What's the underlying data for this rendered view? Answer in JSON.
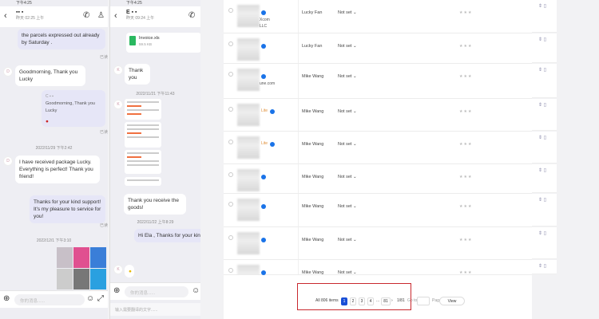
{
  "phone1": {
    "status": "下午4:25",
    "contact_sub": "昨天 02:25 上午",
    "read": "已读",
    "messages": [
      {
        "dir": "out",
        "text": "the parcels expressed out already by Saturday ."
      },
      {
        "dir": "in",
        "text": "Goodmorning, Thank you Lucky"
      },
      {
        "dir": "out",
        "quote": "Goodmorning, Thank you Lucky"
      },
      {
        "dir": "in",
        "text": "I have received package Lucky. Everything is perfect! Thank you friend!"
      },
      {
        "dir": "out",
        "text": "Thanks for your kind support! It's my pleasure to service for you!"
      }
    ],
    "timestamps": [
      "2022/11/29 下午2:42",
      "2022/12/1 下午3:10"
    ],
    "input_placeholder": "你的消息......"
  },
  "phone2": {
    "status": "下午4:25",
    "contact_sub": "昨天 09:24 上午",
    "file_name": "Invoice.xls",
    "file_size": "59.5 KB",
    "messages": [
      {
        "dir": "in",
        "text": "Thank you"
      },
      {
        "dir": "in",
        "text": "Thank you receive the goods!"
      },
      {
        "dir": "out",
        "text": "Hi Ela , Thanks for your kind support! It's my pleasure to service for you!"
      }
    ],
    "timestamps": [
      "2022/11/21 下午11:43",
      "2022/11/22 上午8:29"
    ],
    "input_placeholder": "你的消息......",
    "translate_placeholder": "输入需要翻译的文字......"
  },
  "table": {
    "rows": [
      {
        "owner": "Lucky Fan",
        "status": "Not set",
        "ext": [
          "Xcom",
          "LLC"
        ],
        "tag": ""
      },
      {
        "owner": "Lucky Fan",
        "status": "Not set",
        "ext": [],
        "tag": ""
      },
      {
        "owner": "Mike Wang",
        "status": "Not set",
        "ext": [
          "une.com"
        ],
        "tag": ""
      },
      {
        "owner": "Mike Wang",
        "status": "Not set",
        "ext": [],
        "tag": "Lite"
      },
      {
        "owner": "Mike Wang",
        "status": "Not set",
        "ext": [],
        "tag": "Lite"
      },
      {
        "owner": "Mike Wang",
        "status": "Not set",
        "ext": [],
        "tag": ""
      },
      {
        "owner": "Mike Wang",
        "status": "Not set",
        "ext": [],
        "tag": ""
      },
      {
        "owner": "Mike Wang",
        "status": "Not set",
        "ext": [],
        "tag": ""
      },
      {
        "owner": "Mike Wang",
        "status": "Not set",
        "ext": [],
        "tag": ""
      }
    ]
  },
  "pagination": {
    "total": "All 806 items",
    "pages": [
      "1",
      "2",
      "3",
      "4"
    ],
    "ellipsis": "...",
    "last": "81",
    "current_of": "1/81",
    "goto": "Go to",
    "page": "Page",
    "view": "View"
  },
  "colors": {
    "accent": "#1a4fd6",
    "highlight": "#c8282e"
  }
}
